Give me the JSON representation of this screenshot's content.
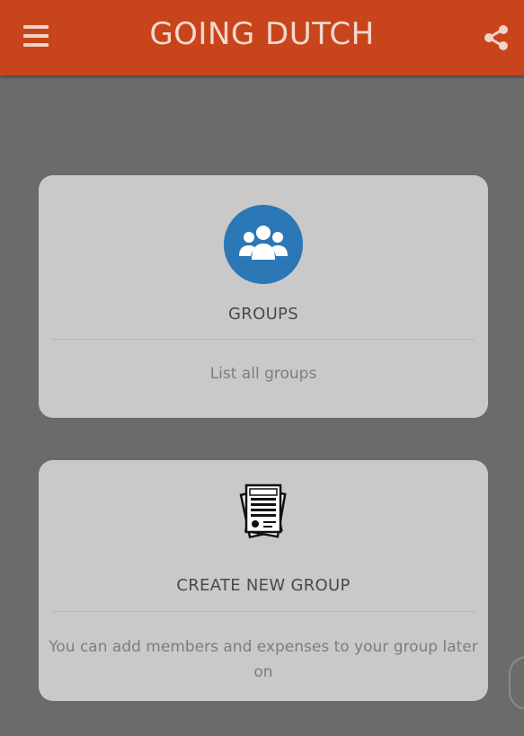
{
  "app_bar": {
    "title": "GOING DUTCH",
    "menu_icon": "hamburger-menu-icon",
    "share_icon": "share-icon",
    "color": "#c8441a"
  },
  "cards": [
    {
      "title": "GROUPS",
      "description": "List all groups",
      "icon": "groups-icon",
      "icon_color": "#2c77b5"
    },
    {
      "title": "CREATE NEW GROUP",
      "description": "You can add members and expenses to your group later on",
      "icon": "invoice-icon"
    }
  ]
}
